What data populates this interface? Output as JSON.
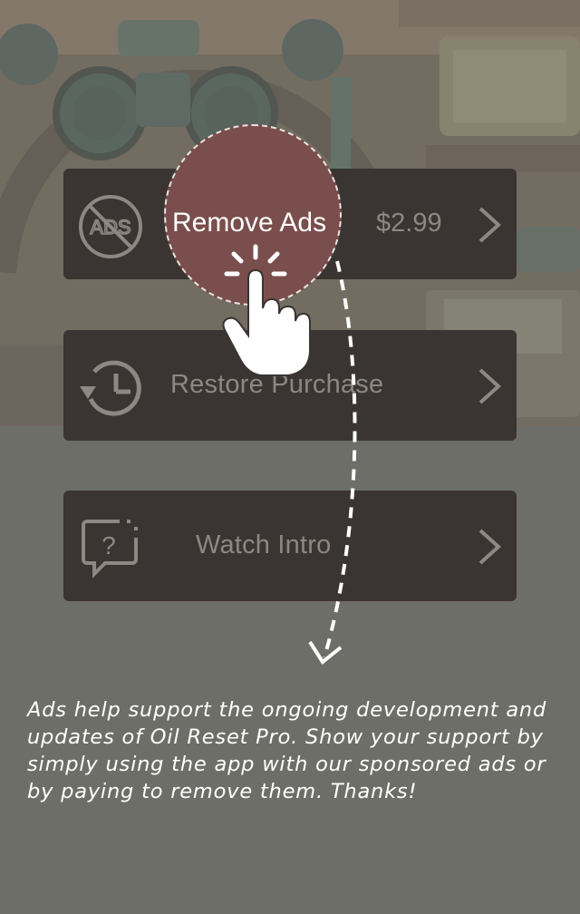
{
  "menu": {
    "remove_ads": {
      "label": "Remove Ads",
      "price": "$2.99",
      "icon": "no-ads-icon",
      "icon_text": "ADS"
    },
    "restore_purchase": {
      "label": "Restore Purchase",
      "icon": "restore-history-icon"
    },
    "watch_intro": {
      "label": "Watch Intro",
      "icon": "help-chat-icon",
      "icon_text": "?"
    }
  },
  "tutorial": {
    "message": "Ads help support the ongoing development and updates of Oil Reset Pro. Show your support by simply using the app with our sponsored ads or by paying to remove them. Thanks!"
  },
  "colors": {
    "button_bg": "#3a3432",
    "highlight": "#7a4e4c",
    "overlay": "#6f6f69",
    "text_muted": "#8e8782"
  }
}
